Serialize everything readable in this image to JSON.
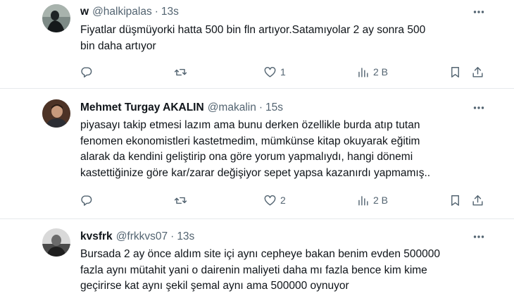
{
  "tweets": [
    {
      "name": "w",
      "handle": "@halkipalas",
      "separator": "·",
      "time": "13s",
      "text_lines": [
        "Fiyatlar düşmüyorki hatta 500 bin fln artıyor.Satamıyolar 2 ay sonra 500",
        "bin daha artıyor"
      ],
      "likes": "1",
      "views": "2 B"
    },
    {
      "name": "Mehmet Turgay AKALIN",
      "handle": "@makalin",
      "separator": "·",
      "time": "15s",
      "text_lines": [
        "piyasayı takip etmesi lazım ama bunu derken özellikle burda atıp tutan",
        "fenomen ekonomistleri kastetmedim, mümkünse kitap okuyarak eğitim",
        "alarak da kendini geliştirip ona göre yorum yapmalıydı, hangi dönemi",
        "kastettiğinize göre kar/zarar değişiyor sepet yapsa kazanırdı yapmamış.."
      ],
      "likes": "2",
      "views": "2 B"
    },
    {
      "name": "kvsfrk",
      "handle": "@frkkvs07",
      "separator": "·",
      "time": "13s",
      "text_lines": [
        "Bursada 2 ay önce aldım site içi aynı cepheye bakan benim evden 500000",
        "fazla aynı mütahit yani o dairenin maliyeti daha mı fazla bence kim kime",
        "geçirirse kat aynı şekil şemal aynı ama 500000 oynuyor"
      ]
    }
  ],
  "icons": {
    "more": "more-horizontal-icon",
    "reply": "reply-icon",
    "retweet": "retweet-icon",
    "like": "heart-icon",
    "views": "views-chart-icon",
    "bookmark": "bookmark-icon",
    "share": "share-icon"
  },
  "colors": {
    "text": "#0f1419",
    "muted": "#536471",
    "divider": "#e6e9ec"
  }
}
